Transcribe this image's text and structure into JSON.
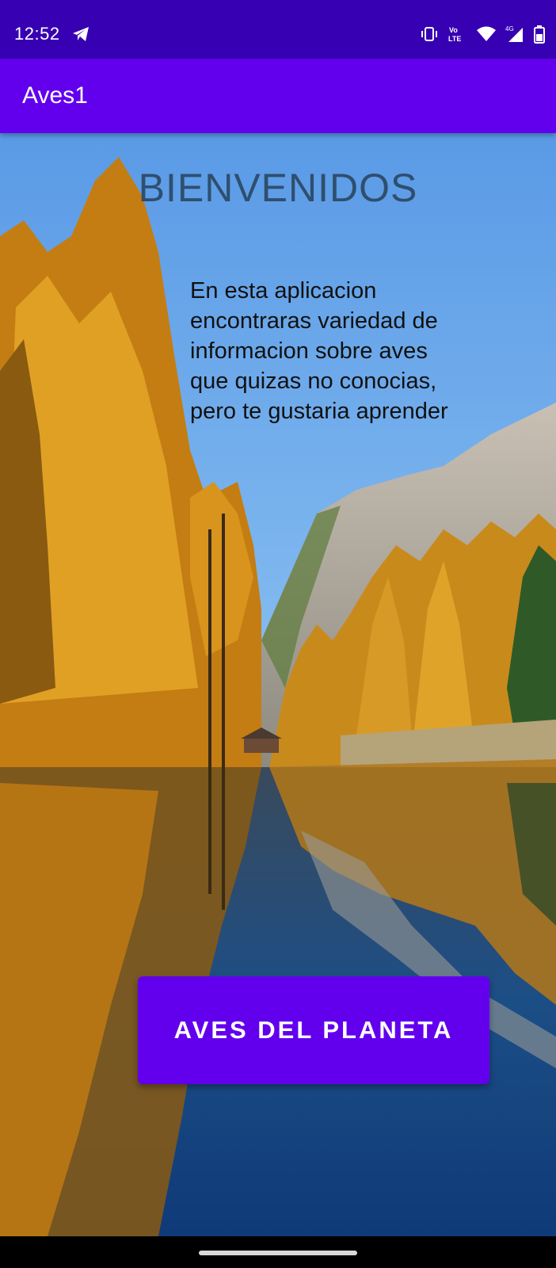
{
  "status_bar": {
    "time": "12:52",
    "left_icon": "telegram-icon",
    "icons": [
      "vibrate-icon",
      "volte-icon",
      "wifi-icon",
      "cell-signal-4g-icon",
      "battery-icon"
    ],
    "volte_text": "Vo LTE",
    "network_label": "4G"
  },
  "app_bar": {
    "title": "Aves1"
  },
  "main": {
    "title": "BIENVENIDOS",
    "description": "En esta aplicacion encontraras variedad de informacion sobre aves que quizas no conocias, pero te gustaria aprender",
    "button_label": "AVES DEL PLANETA",
    "background": "autumn-lake-mountain-landscape"
  },
  "colors": {
    "status_bar": "#3700b3",
    "app_bar": "#6200ee",
    "button": "#6200ee",
    "title_text": "#2f4f6f"
  }
}
